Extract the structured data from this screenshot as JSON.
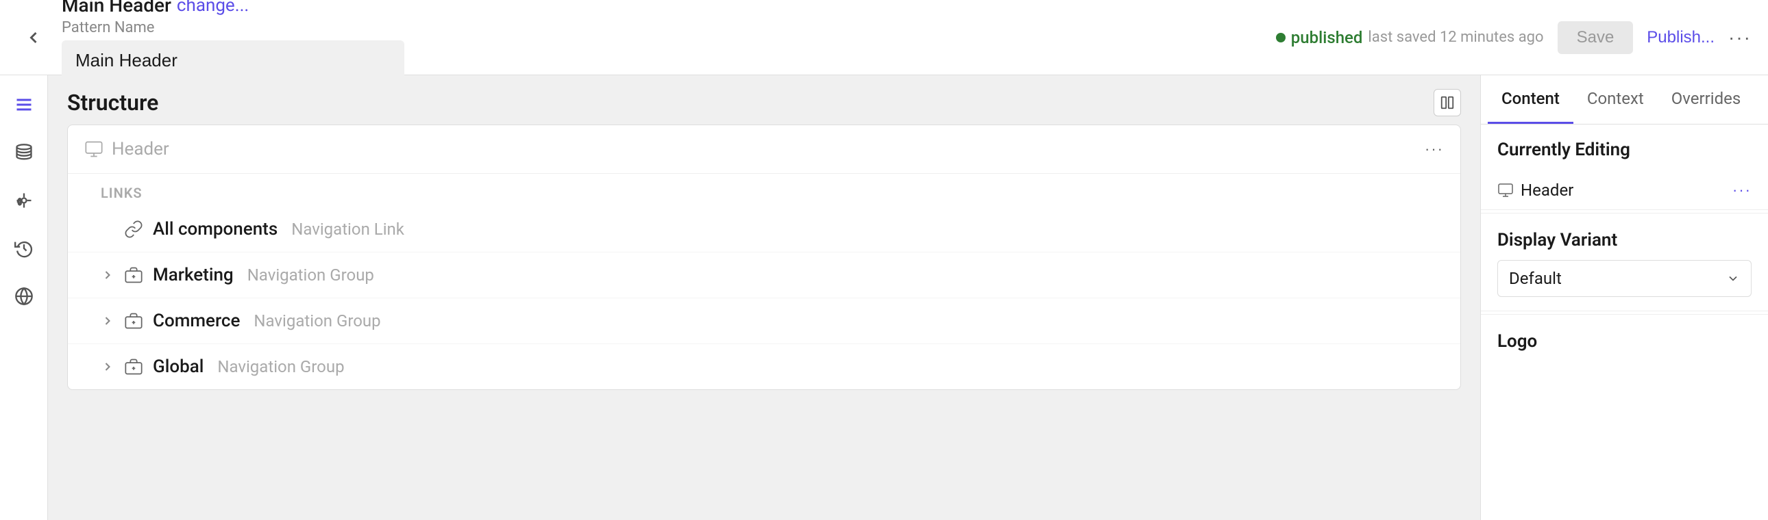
{
  "topBar": {
    "title": "Main Header",
    "changeLink": "change...",
    "patternNameLabel": "Pattern Name",
    "patternNameValue": "Main Header",
    "statusText": "published",
    "lastSaved": "last saved 12 minutes ago",
    "saveLabel": "Save",
    "publishLabel": "Publish...",
    "moreLabel": "···"
  },
  "sidebar": {
    "icons": [
      {
        "name": "back-arrow",
        "symbol": "‹"
      },
      {
        "name": "structure-icon"
      },
      {
        "name": "database-icon"
      },
      {
        "name": "code-icon"
      },
      {
        "name": "history-icon"
      },
      {
        "name": "globe-icon"
      }
    ]
  },
  "structure": {
    "title": "Structure",
    "headerLabel": "Header",
    "linksLabel": "LINKS",
    "items": [
      {
        "id": "all-components",
        "name": "All components",
        "type": "Navigation Link",
        "hasChevron": false
      },
      {
        "id": "marketing",
        "name": "Marketing",
        "type": "Navigation Group",
        "hasChevron": true
      },
      {
        "id": "commerce",
        "name": "Commerce",
        "type": "Navigation Group",
        "hasChevron": true
      },
      {
        "id": "global",
        "name": "Global",
        "type": "Navigation Group",
        "hasChevron": true
      }
    ]
  },
  "rightPanel": {
    "tabs": [
      {
        "id": "content",
        "label": "Content",
        "active": true
      },
      {
        "id": "context",
        "label": "Context",
        "active": false
      },
      {
        "id": "overrides",
        "label": "Overrides",
        "active": false
      }
    ],
    "currentlyEditingTitle": "Currently Editing",
    "currentlyEditingItem": "Header",
    "displayVariantTitle": "Display Variant",
    "displayVariantValue": "Default",
    "logoTitle": "Logo"
  }
}
